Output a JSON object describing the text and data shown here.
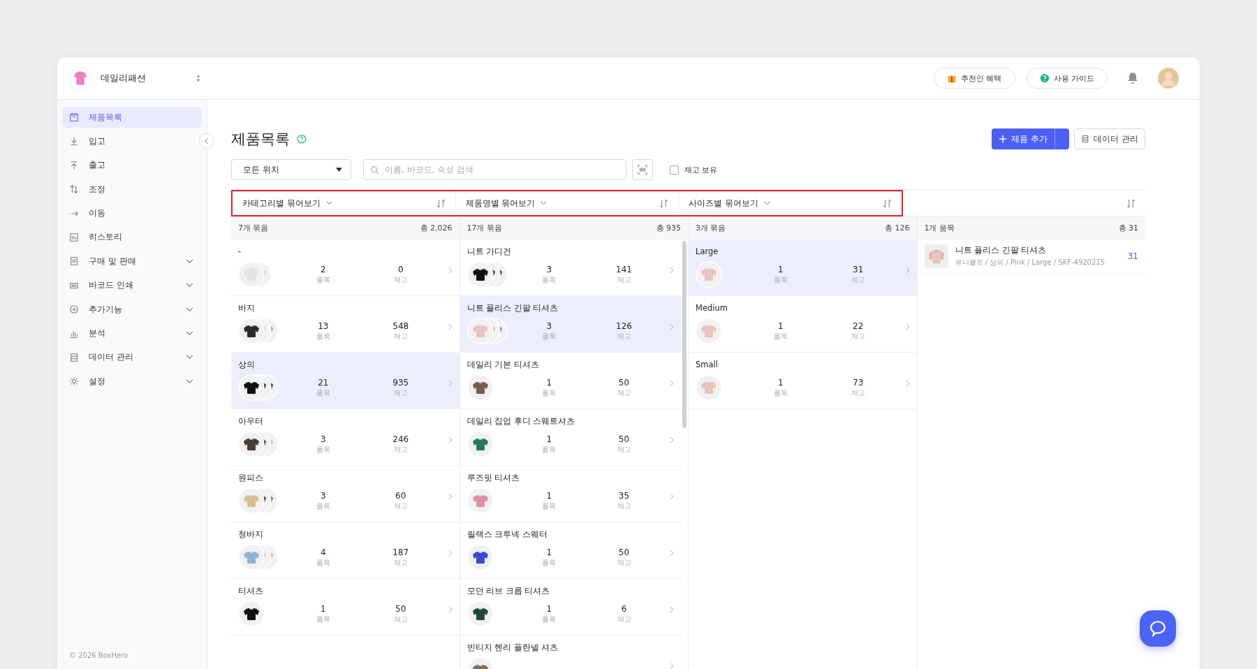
{
  "workspace": {
    "name": "데일리패션"
  },
  "header_buttons": [
    {
      "label": "추천인 혜택",
      "kind": "gift"
    },
    {
      "label": "사용 가이드",
      "kind": "guide"
    }
  ],
  "sidebar": {
    "items": [
      {
        "label": "제품목록",
        "kind": "link",
        "selected": true
      },
      {
        "label": "입고",
        "kind": "link",
        "selected": false
      },
      {
        "label": "출고",
        "kind": "link",
        "selected": false
      },
      {
        "label": "조정",
        "kind": "link",
        "selected": false
      },
      {
        "label": "이동",
        "kind": "link",
        "selected": false
      },
      {
        "label": "히스토리",
        "kind": "link",
        "selected": false
      },
      {
        "label": "구매 및 판매",
        "kind": "group",
        "selected": false
      },
      {
        "label": "바코드 인쇄",
        "kind": "group",
        "selected": false
      },
      {
        "label": "추가기능",
        "kind": "group",
        "selected": false
      },
      {
        "label": "분석",
        "kind": "group",
        "selected": false
      },
      {
        "label": "데이터 관리",
        "kind": "group",
        "selected": false
      },
      {
        "label": "설정",
        "kind": "group",
        "selected": false
      }
    ],
    "footer": "© 2026 BoxHero"
  },
  "page": {
    "title": "제품목록",
    "add_button": "제품 추가",
    "data_button": "데이터 관리"
  },
  "filters": {
    "location": "모든 위치",
    "search": {
      "placeholder": "이름, 바코드, 속성 검색"
    },
    "in_stock": {
      "label": "재고 보유",
      "checked": false
    }
  },
  "board": {
    "grouping_highlighted": true,
    "columns": [
      {
        "kind": "groups",
        "header": "카테고리별 묶어보기",
        "summary_count": "7개 묶음",
        "summary_total": "총 2,026",
        "rows": [
          {
            "name": "-",
            "items": "2",
            "items_label": "품목",
            "stock": "0",
            "stock_label": "재고",
            "selected": false
          },
          {
            "name": "바지",
            "items": "13",
            "items_label": "품목",
            "stock": "548",
            "stock_label": "재고",
            "selected": false
          },
          {
            "name": "상의",
            "items": "21",
            "items_label": "품목",
            "stock": "935",
            "stock_label": "재고",
            "selected": true
          },
          {
            "name": "아우터",
            "items": "3",
            "items_label": "품목",
            "stock": "246",
            "stock_label": "재고",
            "selected": false
          },
          {
            "name": "원피스",
            "items": "3",
            "items_label": "품목",
            "stock": "60",
            "stock_label": "재고",
            "selected": false
          },
          {
            "name": "청바지",
            "items": "4",
            "items_label": "품목",
            "stock": "187",
            "stock_label": "재고",
            "selected": false
          },
          {
            "name": "티셔츠",
            "items": "1",
            "items_label": "품목",
            "stock": "50",
            "stock_label": "재고",
            "selected": false
          }
        ]
      },
      {
        "kind": "groups",
        "header": "제품명별 묶어보기",
        "summary_count": "17개 묶음",
        "summary_total": "총 935",
        "rows": [
          {
            "name": "니트 가디건",
            "items": "3",
            "items_label": "품목",
            "stock": "141",
            "stock_label": "재고",
            "selected": false
          },
          {
            "name": "니트 플리스 긴팔 티셔츠",
            "items": "3",
            "items_label": "품목",
            "stock": "126",
            "stock_label": "재고",
            "selected": true
          },
          {
            "name": "데일리 기본 티셔츠",
            "items": "1",
            "items_label": "품목",
            "stock": "50",
            "stock_label": "재고",
            "selected": false
          },
          {
            "name": "데일리 집업 후디 스웨트셔츠",
            "items": "1",
            "items_label": "품목",
            "stock": "50",
            "stock_label": "재고",
            "selected": false
          },
          {
            "name": "루즈핏 티셔츠",
            "items": "1",
            "items_label": "품목",
            "stock": "35",
            "stock_label": "재고",
            "selected": false
          },
          {
            "name": "릴랙스 크루넥 스웨터",
            "items": "1",
            "items_label": "품목",
            "stock": "50",
            "stock_label": "재고",
            "selected": false
          },
          {
            "name": "모던 리브 크롭 티셔츠",
            "items": "1",
            "items_label": "품목",
            "stock": "6",
            "stock_label": "재고",
            "selected": false
          },
          {
            "name": "빈티지 헨리 플란넬 셔츠",
            "selected": false
          }
        ]
      },
      {
        "kind": "groups",
        "header": "사이즈별 묶어보기",
        "summary_count": "3개 묶음",
        "summary_total": "총 126",
        "rows": [
          {
            "name": "Large",
            "items": "1",
            "items_label": "품목",
            "stock": "31",
            "stock_label": "재고",
            "selected": true
          },
          {
            "name": "Medium",
            "items": "1",
            "items_label": "품목",
            "stock": "22",
            "stock_label": "재고",
            "selected": false
          },
          {
            "name": "Small",
            "items": "1",
            "items_label": "품목",
            "stock": "73",
            "stock_label": "재고",
            "selected": false
          }
        ]
      },
      {
        "kind": "products",
        "summary_count": "1개 품목",
        "summary_total": "총 31",
        "rows": [
          {
            "name": "니트 플리스 긴팔 티셔츠",
            "details": "유니클로 / 상의 / Pink / Large / SKF-4920215",
            "stock": "31"
          }
        ]
      }
    ]
  }
}
